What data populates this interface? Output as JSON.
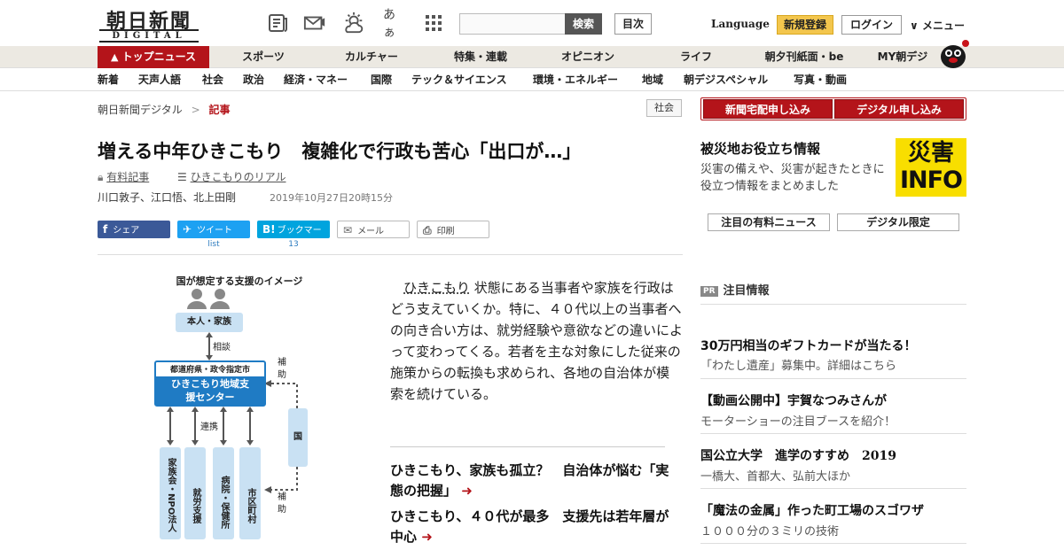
{
  "header": {
    "logo_main": "朝日新聞",
    "logo_sub": "DIGITAL",
    "icons": [
      "newspaper-icon",
      "mail-icon",
      "weather-icon",
      "font-size-icon",
      "grid-icon"
    ],
    "font_icon_text": "あぁ",
    "search_placeholder": "",
    "search_label": "検索",
    "toc_label": "目次",
    "language_label": "Language",
    "register_label": "新規登録",
    "login_label": "ログイン",
    "menu_label": "メニュー"
  },
  "main_nav": [
    "トップニュース",
    "スポーツ",
    "カルチャー",
    "特集・連載",
    "オピニオン",
    "ライフ",
    "朝夕刊紙面・be",
    "MY朝デジ"
  ],
  "sub_nav": [
    "新着",
    "天声人語",
    "社会",
    "政治",
    "経済・マネー",
    "国際",
    "テック＆サイエンス",
    "環境・エネルギー",
    "地域",
    "朝デジスペシャル",
    "写真・動画"
  ],
  "breadcrumb": {
    "home": "朝日新聞デジタル",
    "separator": ">",
    "current": "記事"
  },
  "category_badge": "社会",
  "article": {
    "title": "増える中年ひきこもり　複雑化で行政も苦心「出口が…」",
    "paid_label": "有料記事",
    "series_label": "ひきこもりのリアル",
    "authors": "川口敦子、江口悟、北上田剛",
    "date": "2019年10月27日20時15分",
    "share": {
      "facebook": "シェア",
      "twitter": "ツイート",
      "twitter_count": "list",
      "hatena": "ブックマーク",
      "hatena_count": "13",
      "mail": "メール",
      "print": "印刷"
    },
    "body_link": "ひきこもり",
    "body": "状態にある当事者や家族を行政はどう支えていくか。特に、４０代以上の当事者への向き合い方は、就労経験や意欲などの違いによって変わってくる。若者を主な対象にした従来の施策からの転換も求められ、各地の自治体が模索を続けている。",
    "related": [
      "ひきこもり、家族も孤立？　自治体が悩む「実態の把握」",
      "ひきこもり、４０代が最多　支援先は若年層が中心"
    ]
  },
  "diagram": {
    "title": "国が想定する支援のイメージ",
    "person": "本人・家族",
    "consult": "相談",
    "center_top": "都道府県・政令指定市",
    "center_main": "ひきこもり地域支援センター",
    "subsidy_top": "補助",
    "subsidy_bottom": "補助",
    "country": "国",
    "cooperation": "連携",
    "orgs": [
      "家族会・NPO法人",
      "就労支援",
      "病院・保健所",
      "市区町村"
    ]
  },
  "sidebar": {
    "subscribe_paper": "新聞宅配申し込み",
    "subscribe_digital": "デジタル申し込み",
    "disaster_title": "被災地お役立ち情報",
    "disaster_desc": "災害の備えや、災害が起きたときに役立つ情報をまとめました",
    "disaster_logo_top": "災害",
    "disaster_logo_bottom": "INFO",
    "paid_news": "注目の有料ニュース",
    "digital_only": "デジタル限定",
    "pr_badge": "PR",
    "pr_heading": "注目情報",
    "pr_items": [
      {
        "title": "30万円相当のギフトカードが当たる！",
        "sub": "「わたし遺産」募集中。詳細はこちら"
      },
      {
        "title": "【動画公開中】宇賀なつみさんが",
        "sub": "モーターショーの注目ブースを紹介！"
      },
      {
        "title": "国公立大学　進学のすすめ　2019",
        "sub": "一橋大、首都大、弘前大ほか"
      },
      {
        "title": "「魔法の金属」作った町工場のスゴワザ",
        "sub": "１０００分の３ミリの技術"
      }
    ]
  },
  "colors": {
    "brand_red": "#b4141a",
    "register_yellow": "#f3c64d",
    "facebook": "#3b5998",
    "twitter": "#1da1f2",
    "hatena": "#00a4de",
    "diagram_blue": "#c9e1f3",
    "center_blue": "#1f7bc4"
  }
}
